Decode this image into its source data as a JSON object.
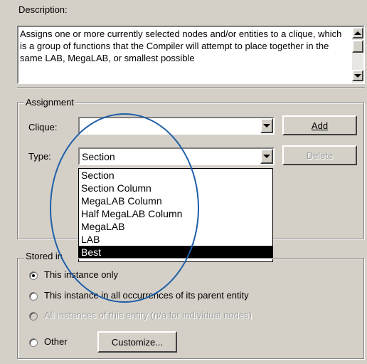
{
  "description": {
    "label": "Description:",
    "text": "Assigns one or more currently selected nodes and/or entities to a clique, which is a group of functions that the Compiler will attempt to place together in the same LAB, MegaLAB, or smallest possible"
  },
  "assignment": {
    "legend": "Assignment",
    "clique_label": "Clique:",
    "clique_value": "",
    "type_label": "Type:",
    "type_value": "Section",
    "add_label": "Add",
    "delete_label": "Delete",
    "type_options": [
      "Section",
      "Section Column",
      "MegaLAB Column",
      "Half MegaLAB Column",
      "MegaLAB",
      "LAB",
      "Best"
    ],
    "highlighted_option": "Best"
  },
  "stored": {
    "legend": "Stored in",
    "options": [
      {
        "label": "This instance only",
        "selected": true,
        "enabled": true
      },
      {
        "label": "This instance in all occurrences of its parent entity",
        "selected": false,
        "enabled": true
      },
      {
        "label": "All instances of this entity (n/a for individual nodes)",
        "selected": false,
        "enabled": false
      },
      {
        "label": "Other",
        "selected": false,
        "enabled": true
      }
    ],
    "customize_label": "Customize..."
  },
  "annotation": {
    "color": "#1f5fa8"
  }
}
